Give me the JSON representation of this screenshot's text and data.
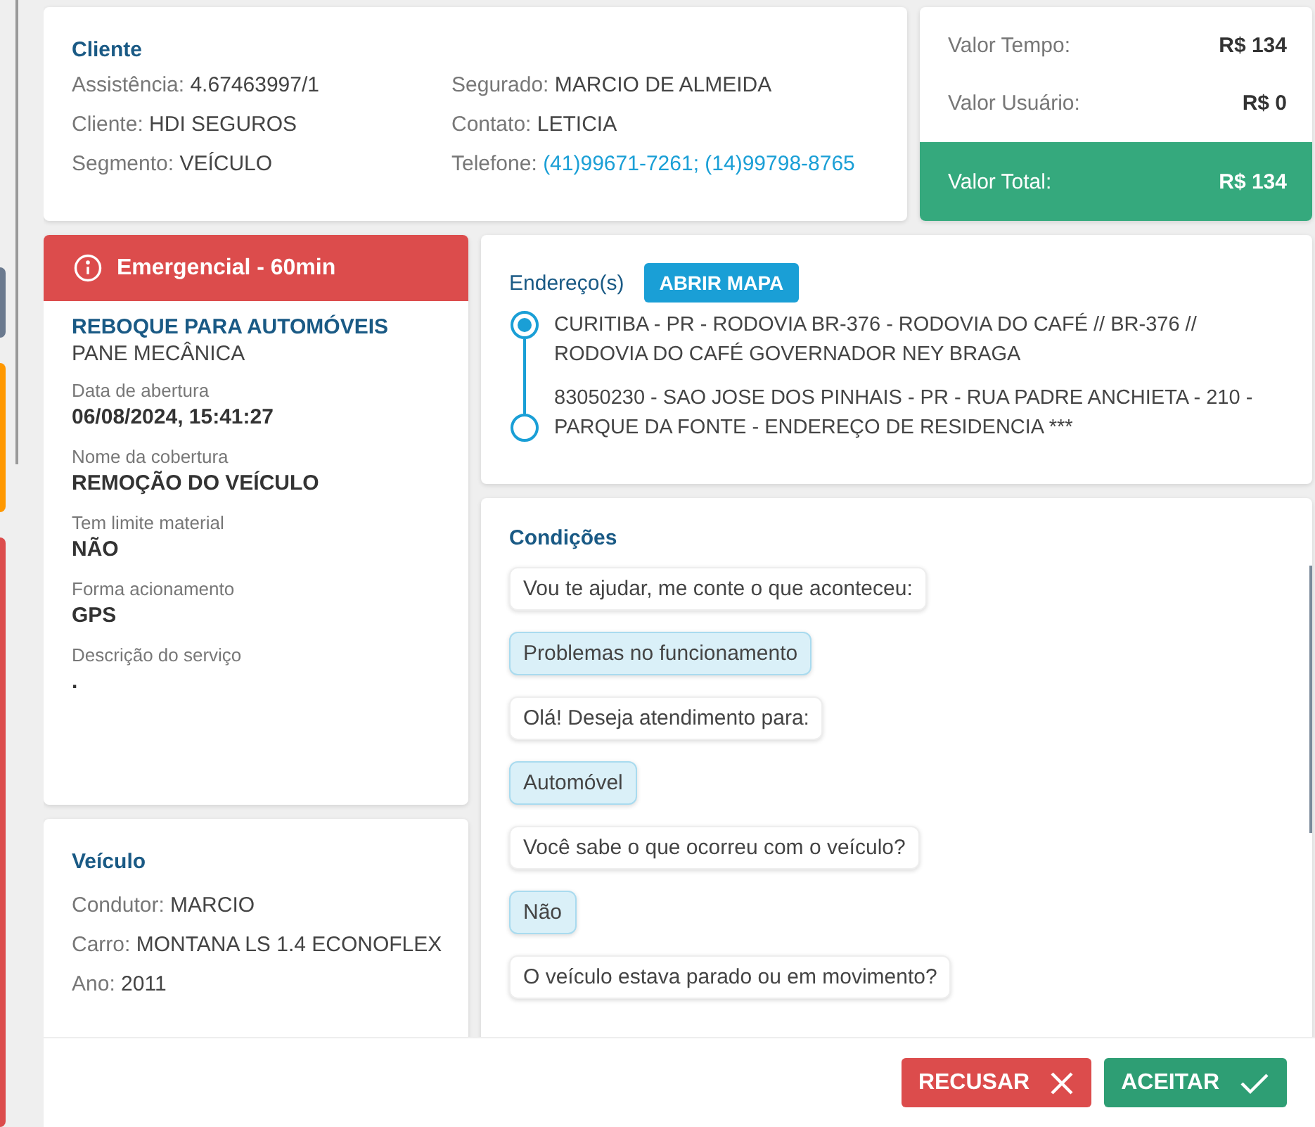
{
  "side_tabs": [
    {
      "color": "#6b7a8f"
    },
    {
      "color": "#ff9800"
    },
    {
      "color": "#dc4c4c"
    }
  ],
  "cliente": {
    "title": "Cliente",
    "fields": [
      {
        "label": "Assistência:",
        "value": "4.67463997/1",
        "kind": "text"
      },
      {
        "label": "Segurado:",
        "value": "MARCIO DE ALMEIDA",
        "kind": "text"
      },
      {
        "label": "Cliente:",
        "value": "HDI SEGUROS",
        "kind": "text"
      },
      {
        "label": "Contato:",
        "value": "LETICIA",
        "kind": "text"
      },
      {
        "label": "Segmento:",
        "value": "VEÍCULO",
        "kind": "text"
      },
      {
        "label": "Telefone:",
        "value": "(41)99671-7261; (14)99798-8765",
        "kind": "link"
      }
    ]
  },
  "valores": [
    {
      "label": "Valor Tempo:",
      "value": "R$ 134",
      "total": false
    },
    {
      "label": "Valor Usuário:",
      "value": "R$ 0",
      "total": false
    },
    {
      "label": "Valor Total:",
      "value": "R$ 134",
      "total": true
    }
  ],
  "servico": {
    "priority": "Emergencial - 60min",
    "title": "REBOQUE PARA AUTOMÓVEIS",
    "subtitle": "PANE MECÂNICA",
    "details": [
      {
        "label": "Data de abertura",
        "value": "06/08/2024, 15:41:27"
      },
      {
        "label": "Nome da cobertura",
        "value": "REMOÇÃO DO VEÍCULO"
      },
      {
        "label": "Tem limite material",
        "value": "NÃO"
      },
      {
        "label": "Forma acionamento",
        "value": "GPS"
      },
      {
        "label": "Descrição do serviço",
        "value": "."
      }
    ]
  },
  "veiculo": {
    "title": "Veículo",
    "fields": [
      {
        "label": "Condutor:",
        "value": "MARCIO"
      },
      {
        "label": "Carro:",
        "value": "MONTANA LS 1.4 ECONOFLEX"
      },
      {
        "label": "Ano:",
        "value": "2011"
      }
    ]
  },
  "enderecos": {
    "title": "Endereço(s)",
    "map_button": "ABRIR MAPA",
    "items": [
      {
        "text": "CURITIBA - PR - RODOVIA BR-376 - RODOVIA DO CAFÉ // BR-376 // RODOVIA DO CAFÉ GOVERNADOR NEY BRAGA",
        "selected": true
      },
      {
        "text": "83050230 - SAO JOSE DOS PINHAIS - PR - RUA PADRE ANCHIETA - 210 - PARQUE DA FONTE - ENDEREÇO DE RESIDENCIA ***",
        "selected": false
      }
    ]
  },
  "condicoes": {
    "title": "Condições",
    "messages": [
      {
        "text": "Vou te ajudar, me conte o que aconteceu:",
        "kind": "question"
      },
      {
        "text": "Problemas no funcionamento",
        "kind": "answer"
      },
      {
        "text": "Olá! Deseja atendimento para:",
        "kind": "question"
      },
      {
        "text": "Automóvel",
        "kind": "answer"
      },
      {
        "text": "Você sabe o que ocorreu com o veículo?",
        "kind": "question"
      },
      {
        "text": "Não",
        "kind": "answer"
      },
      {
        "text": "O veículo estava parado ou em movimento?",
        "kind": "question"
      }
    ]
  },
  "actions": [
    {
      "label": "RECUSAR",
      "kind": "reject"
    },
    {
      "label": "ACEITAR",
      "kind": "accept"
    }
  ]
}
